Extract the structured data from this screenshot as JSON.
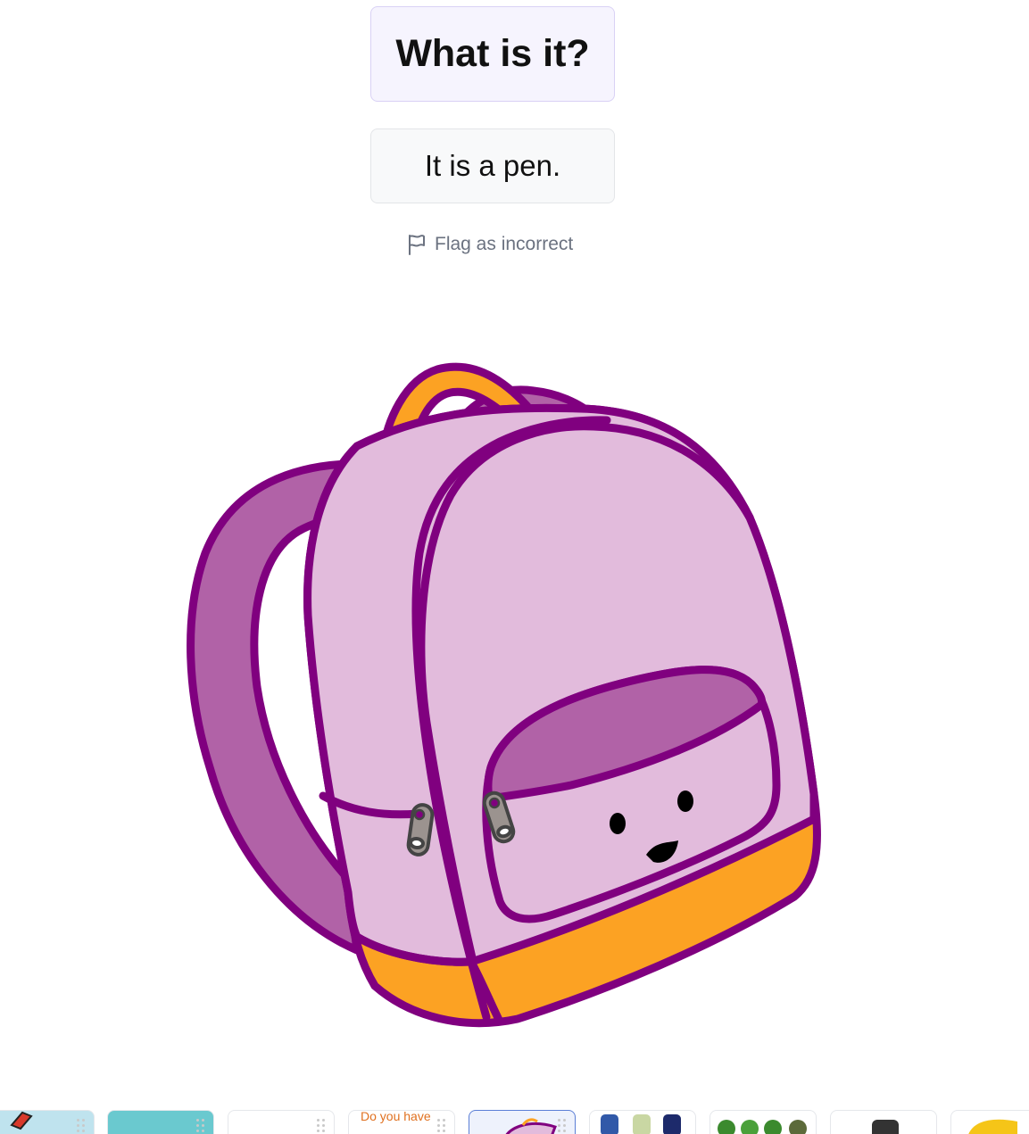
{
  "question": "What is it?",
  "answer": "It is a pen.",
  "flag_label": "Flag as incorrect",
  "icons": {
    "flag": "flag-icon",
    "drag_handle": "drag-handle-icon"
  },
  "colors": {
    "question_bg": "#f6f4fe",
    "answer_bg": "#f8f9fa",
    "bag_outline": "#80007f",
    "bag_body": "#e2bbdc",
    "bag_dark": "#b162a7",
    "bag_accent": "#fca223"
  },
  "thumbnails": [
    {
      "name": "thumb-1",
      "text": ""
    },
    {
      "name": "thumb-2",
      "text": ""
    },
    {
      "name": "thumb-3",
      "text": ""
    },
    {
      "name": "thumb-4",
      "text": "Do you have"
    },
    {
      "name": "thumb-5",
      "text": "",
      "selected": true
    },
    {
      "name": "thumb-6",
      "text": ""
    },
    {
      "name": "thumb-7",
      "text": ""
    },
    {
      "name": "thumb-8",
      "text": ""
    },
    {
      "name": "thumb-9",
      "text": ""
    }
  ]
}
